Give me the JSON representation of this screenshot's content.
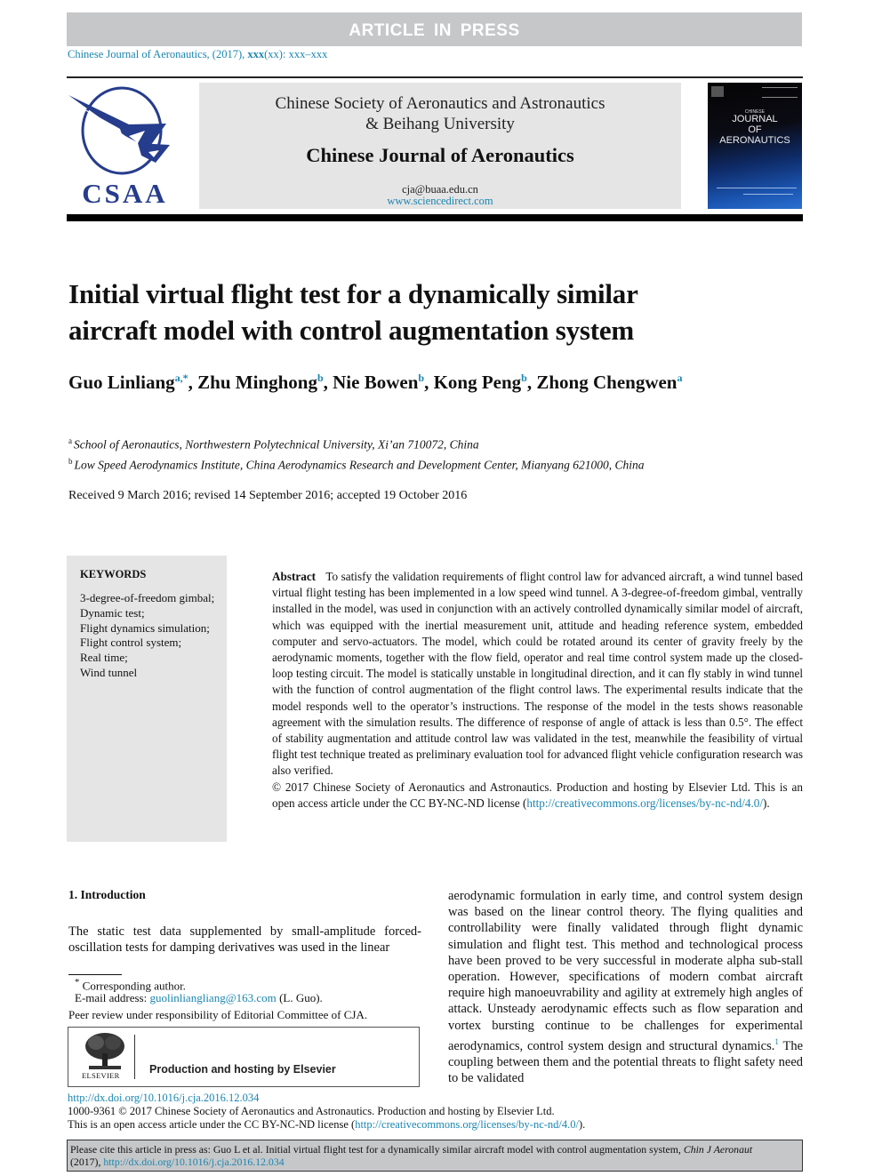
{
  "banner": {
    "text": "ARTICLE IN PRESS"
  },
  "journal_ref": {
    "prefix": "Chinese Journal of Aeronautics, (2017), ",
    "volume": "xxx",
    "suffix": "(xx): xxx–xxx"
  },
  "header": {
    "logo_text": "CSAA",
    "society_line1": "Chinese Society of Aeronautics and Astronautics",
    "society_line2": "& Beihang University",
    "journal_name": "Chinese Journal of Aeronautics",
    "email": "cja@buaa.edu.cn",
    "website": "www.sciencedirect.com",
    "cover": {
      "chinese": "CHINESE",
      "line1": "JOURNAL",
      "line2": "OF",
      "line3": "AERONAUTICS"
    }
  },
  "article": {
    "title_line1": "Initial virtual flight test for a dynamically similar",
    "title_line2": "aircraft model with control augmentation system",
    "authors": [
      {
        "name": "Guo Linliang",
        "sup": "a,*"
      },
      {
        "name": "Zhu Minghong",
        "sup": "b"
      },
      {
        "name": "Nie Bowen",
        "sup": "b"
      },
      {
        "name": "Kong Peng",
        "sup": "b"
      },
      {
        "name": "Zhong Chengwen",
        "sup": "a"
      }
    ],
    "affiliations": [
      {
        "mark": "a",
        "text": "School of Aeronautics, Northwestern Polytechnical University, Xi’an 710072, China"
      },
      {
        "mark": "b",
        "text": "Low Speed Aerodynamics Institute, China Aerodynamics Research and Development Center, Mianyang 621000, China"
      }
    ],
    "received": "Received 9 March 2016; revised 14 September 2016; accepted 19 October 2016"
  },
  "keywords": {
    "heading": "KEYWORDS",
    "items": [
      "3-degree-of-freedom gimbal;",
      "Dynamic test;",
      "Flight dynamics simulation;",
      "Flight control system;",
      "Real time;",
      "Wind tunnel"
    ]
  },
  "abstract": {
    "label": "Abstract",
    "text": "To satisfy the validation requirements of flight control law for advanced aircraft, a wind tunnel based virtual flight testing has been implemented in a low speed wind tunnel. A 3-degree-of-freedom gimbal, ventrally installed in the model, was used in conjunction with an actively controlled dynamically similar model of aircraft, which was equipped with the inertial measurement unit, attitude and heading reference system, embedded computer and servo-actuators. The model, which could be rotated around its center of gravity freely by the aerodynamic moments, together with the flow field, operator and real time control system made up the closed-loop testing circuit. The model is statically unstable in longitudinal direction, and it can fly stably in wind tunnel with the function of control augmentation of the flight control laws. The experimental results indicate that the model responds well to the operator’s instructions. The response of the model in the tests shows reasonable agreement with the simulation results. The difference of response of angle of attack is less than 0.5°. The effect of stability augmentation and attitude control law was validated in the test, meanwhile the feasibility of virtual flight test technique treated as preliminary evaluation tool for advanced flight vehicle configuration research was also verified.",
    "copyright": "© 2017 Chinese Society of Aeronautics and Astronautics. Production and hosting by Elsevier Ltd. This is an open access article under the CC BY-NC-ND license (",
    "license_url": "http://creativecommons.org/licenses/by-nc-nd/4.0/",
    "copyright_end": ")."
  },
  "introduction": {
    "heading": "1. Introduction",
    "left_text": "The static test data supplemented by small-amplitude forced-oscillation tests for damping derivatives was used in the linear",
    "right_text_a": "aerodynamic formulation in early time, and control system design was based on the linear control theory. The flying qualities and controllability were finally validated through flight dynamic simulation and flight test. This method and technological process have been proved to be very successful in moderate alpha sub-stall operation. However, specifications of modern combat aircraft require high manoeuvrability and agility at extremely high angles of attack. Unsteady aerodynamic effects such as flow separation and vortex bursting continue to be challenges for experimental aerodynamics, control system design and structural dynamics.",
    "ref_mark": "1",
    "right_text_b": " The coupling between them and the potential threats to flight safety need to be validated"
  },
  "footnotes": {
    "corresponding": "Corresponding author.",
    "corresponding_mark": "*",
    "email_label": "E-mail address: ",
    "email": "guolinliangliang@163.com",
    "email_suffix": " (L. Guo).",
    "peer_review": "Peer review under responsibility of Editorial Committee of CJA."
  },
  "elsevier": {
    "wordmark": "ELSEVIER",
    "production": "Production and hosting by Elsevier"
  },
  "bottom": {
    "doi": "http://dx.doi.org/10.1016/j.cja.2016.12.034",
    "issn": "1000-9361 © 2017 Chinese Society of Aeronautics and Astronautics. Production and hosting by Elsevier Ltd.",
    "oa_prefix": "This is an open access article under the CC BY-NC-ND license (",
    "oa_url": "http://creativecommons.org/licenses/by-nc-nd/4.0/",
    "oa_suffix": ")."
  },
  "citation": {
    "prefix": "Please cite this article in press as: Guo L et al. Initial virtual flight test for a dynamically similar aircraft model with control augmentation system, ",
    "journal": "Chin J Aeronaut",
    "year": "(2017), ",
    "doi": "http://dx.doi.org/10.1016/j.cja.2016.12.034"
  },
  "colors": {
    "link": "#1a86b0",
    "logo_blue": "#263c8c",
    "banner_gray": "#c6c7c9",
    "header_gray": "#e5e5e5"
  }
}
